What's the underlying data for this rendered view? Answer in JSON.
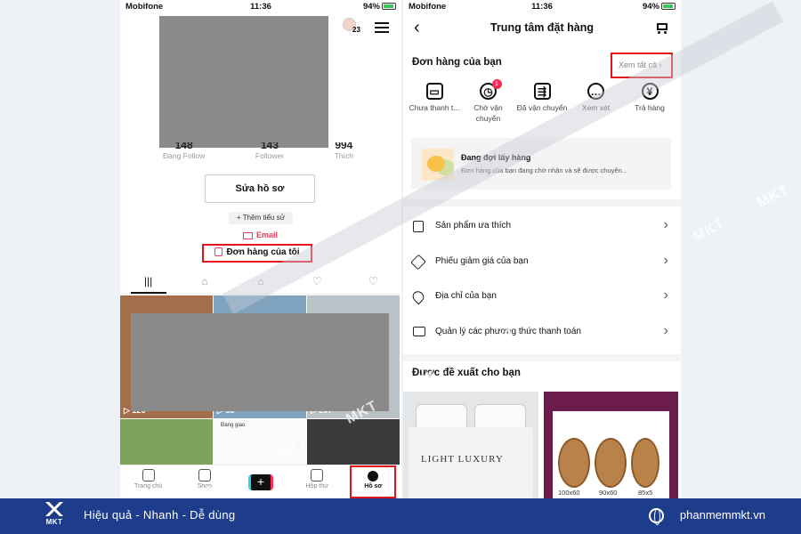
{
  "left": {
    "status": {
      "carrier": "Mobifone",
      "time": "11:36",
      "battery": "94%"
    },
    "avatar_badge": "23",
    "stats": [
      {
        "num": "148",
        "label": "Đang Follow"
      },
      {
        "num": "143",
        "label": "Follower"
      },
      {
        "num": "994",
        "label": "Thích"
      }
    ],
    "edit_profile": "Sửa hồ sơ",
    "add_bio": "+ Thêm tiểu sử",
    "email": "Email",
    "my_orders": "Đơn hàng của tôi",
    "tabs": [
      "|||",
      "⌂",
      "⌂",
      "♡",
      "♡"
    ],
    "views": [
      "126",
      "83",
      "207"
    ],
    "dang_giao": "Đang giao",
    "nav": [
      "Trang chủ",
      "Shop",
      "+",
      "Hộp thư",
      "Hồ sơ"
    ]
  },
  "right": {
    "status": {
      "carrier": "Mobifone",
      "time": "11:36",
      "battery": "94%"
    },
    "title": "Trung tâm đặt hàng",
    "orders_head": "Đơn hàng của bạn",
    "see_all": "Xem tất cả",
    "order_states": [
      {
        "icon": "wallet-icon",
        "label": "Chưa thanh t..."
      },
      {
        "icon": "clock-icon",
        "label": "Chờ vận chuyển",
        "badge": "1"
      },
      {
        "icon": "truck-icon",
        "label": "Đã vận chuyển"
      },
      {
        "icon": "review-icon",
        "label": "Xem xét"
      },
      {
        "icon": "yen-icon",
        "label": "Trả hàng"
      }
    ],
    "pending": {
      "title": "Đang đợi lấy hàng",
      "desc": "Đơn hàng của bạn đang chờ nhận và sẽ được chuyển..."
    },
    "menu": [
      {
        "icon": "bookmark-icon",
        "label": "Sản phẩm ưa thích"
      },
      {
        "icon": "coupon-icon",
        "label": "Phiếu giảm giá của bạn"
      },
      {
        "icon": "location-icon",
        "label": "Địa chỉ của bạn"
      },
      {
        "icon": "card-icon",
        "label": "Quản lý các phương thức thanh toán"
      }
    ],
    "rec_head": "Được đề xuất cho bạn",
    "rec_brand": "LIGHT LUXURY",
    "basket_sizes": [
      "100x60",
      "90x60",
      "85x5"
    ]
  },
  "watermark": "MKT",
  "footer": {
    "logo": "MKT",
    "slogan": "Hiệu quả - Nhanh - Dễ dùng",
    "site": "phanmemmkt.vn"
  },
  "colors": {
    "highlight": "#e3131b",
    "accent": "#fe2c55",
    "footer_bg": "#1d3c8c"
  }
}
